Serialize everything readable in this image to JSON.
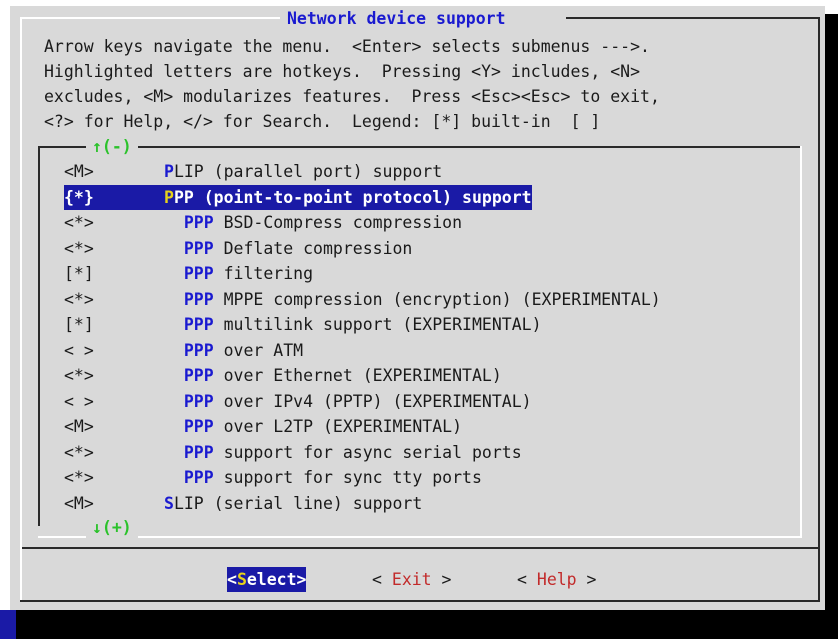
{
  "dialog": {
    "title": "Network device support",
    "help_lines": [
      "Arrow keys navigate the menu.  <Enter> selects submenus --->.",
      "Highlighted letters are hotkeys.  Pressing <Y> includes, <N>",
      "excludes, <M> modularizes features.  Press <Esc><Esc> to exit,",
      "<?> for Help, </> for Search.  Legend: [*] built-in  [ ]"
    ],
    "scroll_up": "↑(-)",
    "scroll_down": "↓(+)"
  },
  "menu": {
    "items": [
      {
        "mark": "<M>",
        "indent": "",
        "hotkey": "P",
        "rest": "LIP (parallel port) support",
        "selected": false
      },
      {
        "mark": "{*}",
        "indent": "",
        "hotkey": "P",
        "rest": "PP (point-to-point protocol) support",
        "selected": true
      },
      {
        "mark": "<*>",
        "indent": "  ",
        "hotkey": "PPP",
        "rest": " BSD-Compress compression",
        "selected": false
      },
      {
        "mark": "<*>",
        "indent": "  ",
        "hotkey": "PPP",
        "rest": " Deflate compression",
        "selected": false
      },
      {
        "mark": "[*]",
        "indent": "  ",
        "hotkey": "PPP",
        "rest": " filtering",
        "selected": false
      },
      {
        "mark": "<*>",
        "indent": "  ",
        "hotkey": "PPP",
        "rest": " MPPE compression (encryption) (EXPERIMENTAL)",
        "selected": false
      },
      {
        "mark": "[*]",
        "indent": "  ",
        "hotkey": "PPP",
        "rest": " multilink support (EXPERIMENTAL)",
        "selected": false
      },
      {
        "mark": "< >",
        "indent": "  ",
        "hotkey": "PPP",
        "rest": " over ATM",
        "selected": false
      },
      {
        "mark": "<*>",
        "indent": "  ",
        "hotkey": "PPP",
        "rest": " over Ethernet (EXPERIMENTAL)",
        "selected": false
      },
      {
        "mark": "< >",
        "indent": "  ",
        "hotkey": "PPP",
        "rest": " over IPv4 (PPTP) (EXPERIMENTAL)",
        "selected": false
      },
      {
        "mark": "<M>",
        "indent": "  ",
        "hotkey": "PPP",
        "rest": " over L2TP (EXPERIMENTAL)",
        "selected": false
      },
      {
        "mark": "<*>",
        "indent": "  ",
        "hotkey": "PPP",
        "rest": " support for async serial ports",
        "selected": false
      },
      {
        "mark": "<*>",
        "indent": "  ",
        "hotkey": "PPP",
        "rest": " support for sync tty ports",
        "selected": false
      },
      {
        "mark": "<M>",
        "indent": "",
        "hotkey": "S",
        "rest": "LIP (serial line) support",
        "selected": false
      }
    ]
  },
  "buttons": {
    "select": {
      "open": "<",
      "hotkey": "S",
      "rest": "elect",
      "close": ">"
    },
    "exit": {
      "open": "< ",
      "hotkey": "E",
      "rest": "xit",
      "close": " >"
    },
    "help": {
      "open": "< ",
      "hotkey": "H",
      "rest": "elp",
      "close": " >"
    }
  },
  "colors": {
    "background": "#d9d9d9",
    "selection": "#1a1aa6",
    "hotkey": "#1a1ad0",
    "selected_hotkey": "#e8d21a",
    "scroll_indicator": "#2bc22b",
    "button_hotkey": "#c22a2a"
  }
}
